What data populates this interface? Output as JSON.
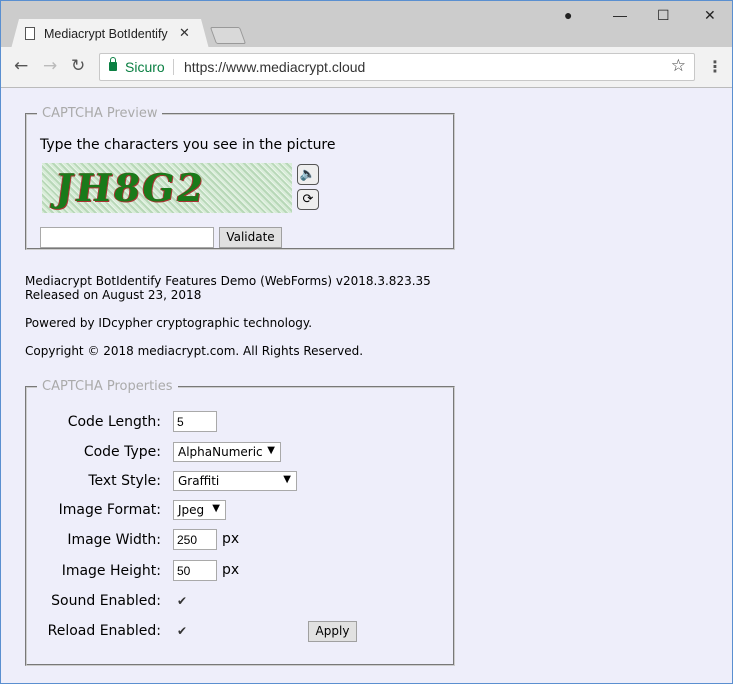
{
  "browser": {
    "tab_title": "Mediacrypt BotIdentify Features Demo",
    "secure_label": "Sicuro",
    "url": "https://www.mediacrypt.cloud"
  },
  "preview": {
    "legend": "CAPTCHA Preview",
    "prompt": "Type the characters you see in the picture",
    "captcha_text": "JH8G2",
    "input_value": "",
    "validate_label": "Validate"
  },
  "info": {
    "version": "Mediacrypt BotIdentify Features Demo (WebForms) v2018.3.823.35",
    "released": "Released on August 23, 2018",
    "powered": "Powered by IDcypher cryptographic technology.",
    "copyright": "Copyright © 2018 mediacrypt.com. All Rights Reserved."
  },
  "props": {
    "legend": "CAPTCHA Properties",
    "code_length_label": "Code Length:",
    "code_length": "5",
    "code_type_label": "Code Type:",
    "code_type": "AlphaNumeric",
    "text_style_label": "Text Style:",
    "text_style": "Graffiti",
    "image_format_label": "Image Format:",
    "image_format": "Jpeg",
    "image_width_label": "Image Width:",
    "image_width": "250",
    "image_height_label": "Image Height:",
    "image_height": "50",
    "px_unit": "px",
    "sound_label": "Sound Enabled:",
    "sound_enabled": true,
    "reload_label": "Reload Enabled:",
    "reload_enabled": true,
    "apply_label": "Apply"
  }
}
